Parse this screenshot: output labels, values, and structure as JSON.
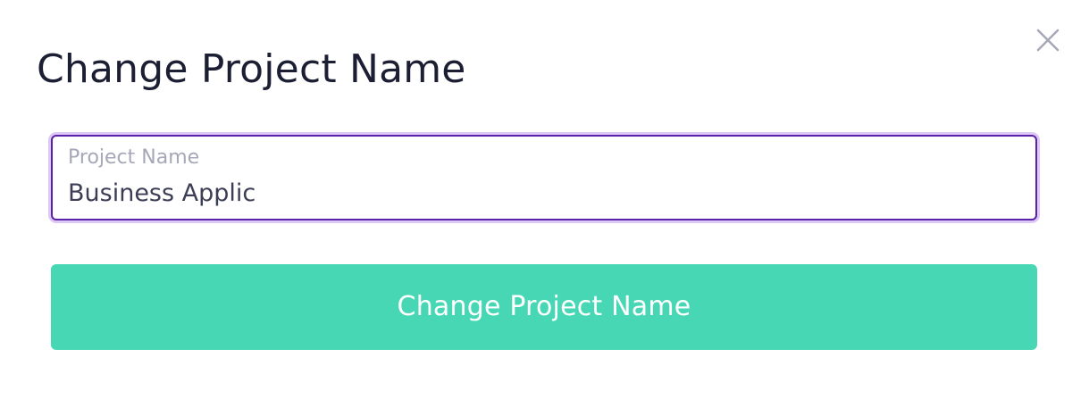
{
  "dialog": {
    "title": "Change Project Name",
    "close_icon": "close-icon",
    "field": {
      "label": "Project Name",
      "value": "Business Applic"
    },
    "submit_label": "Change Project Name"
  },
  "colors": {
    "title_text": "#1c1f33",
    "field_border_focus": "#5b21a8",
    "field_focus_ring": "#dcc8f5",
    "field_label": "#a6a8b8",
    "input_text": "#3b3e54",
    "submit_background": "#47d7b4",
    "submit_text": "#ffffff",
    "close_icon": "#a6a8b8"
  }
}
